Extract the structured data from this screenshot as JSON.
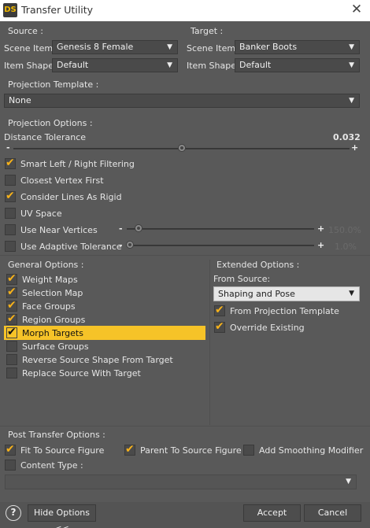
{
  "window": {
    "icon_text": "DS",
    "title": "Transfer Utility",
    "close_glyph": "✕"
  },
  "source": {
    "heading": "Source :",
    "scene_item_label": "Scene Item :",
    "scene_item_value": "Genesis 8 Female",
    "item_shape_label": "Item Shape :",
    "item_shape_value": "Default"
  },
  "target": {
    "heading": "Target :",
    "scene_item_label": "Scene Item :",
    "scene_item_value": "Banker Boots",
    "item_shape_label": "Item Shape :",
    "item_shape_value": "Default"
  },
  "projection_template": {
    "label": "Projection Template :",
    "value": "None"
  },
  "projection_options": {
    "heading": "Projection Options :",
    "distance_tolerance_label": "Distance Tolerance",
    "distance_tolerance_value": "0.032",
    "distance_tolerance_fraction": 0.5,
    "minus": "-",
    "plus": "+",
    "checkboxes": [
      {
        "label": "Smart Left / Right Filtering",
        "checked": true
      },
      {
        "label": "Closest Vertex First",
        "checked": false
      },
      {
        "label": "Consider Lines As Rigid",
        "checked": true
      },
      {
        "label": "UV Space",
        "checked": false
      },
      {
        "label": "Use Near Vertices",
        "checked": false
      },
      {
        "label": "Use Adaptive Tolerance",
        "checked": false
      }
    ],
    "near_vertices_value": "150.0%",
    "adaptive_tolerance_value": "1.0%"
  },
  "general_options": {
    "heading": "General Options :",
    "items": [
      {
        "label": "Weight Maps",
        "checked": true
      },
      {
        "label": "Selection Map",
        "checked": true
      },
      {
        "label": "Face Groups",
        "checked": true
      },
      {
        "label": "Region Groups",
        "checked": true
      },
      {
        "label": "Morph Targets",
        "checked": true,
        "highlighted": true
      },
      {
        "label": "Surface Groups",
        "checked": false
      },
      {
        "label": "Reverse Source Shape From Target",
        "checked": false
      },
      {
        "label": "Replace Source With Target",
        "checked": false
      }
    ]
  },
  "extended_options": {
    "heading": "Extended Options :",
    "from_source_label": "From Source:",
    "from_source_value": "Shaping and Pose",
    "items": [
      {
        "label": "From Projection Template",
        "checked": true
      },
      {
        "label": "Override Existing",
        "checked": true
      }
    ]
  },
  "post_transfer": {
    "heading": "Post Transfer Options :",
    "fit_to_source": {
      "label": "Fit To Source Figure",
      "checked": true
    },
    "parent_to_source": {
      "label": "Parent To Source Figure",
      "checked": true
    },
    "add_smoothing": {
      "label": "Add Smoothing Modifier",
      "checked": false
    },
    "content_type_label": "Content Type :",
    "content_type_checked": false
  },
  "footer": {
    "help_glyph": "?",
    "hide_options_label": "Hide Options <<",
    "accept_label": "Accept",
    "cancel_label": "Cancel"
  },
  "colors": {
    "accent": "#f6c328",
    "check": "#f7b21a",
    "background": "#595959"
  }
}
